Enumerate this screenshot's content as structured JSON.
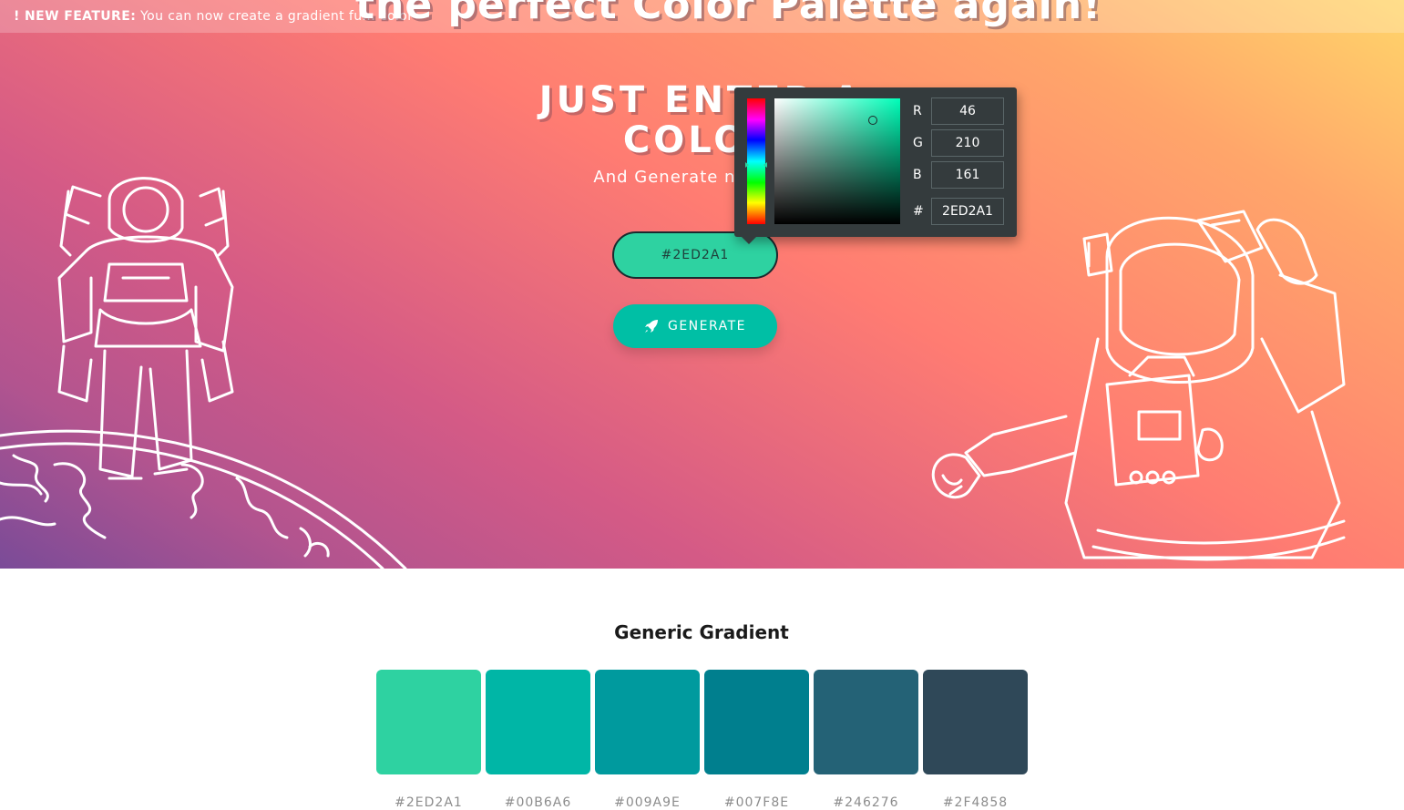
{
  "banner": {
    "label": "! NEW FEATURE:",
    "text": "You can now create a gradient fu... color"
  },
  "hero": {
    "title": "the perfect Color Palette again!",
    "headline_line1": "JUST ENTER A",
    "headline_line2": "COLOR",
    "subtitle": "And Generate nice Co...",
    "color_input_value": "#2ED2A1",
    "generate_label": "GENERATE",
    "generate_icon": "rocket-icon",
    "illustrations": [
      "astronaut-on-planet",
      "astronaut-waving"
    ]
  },
  "picker": {
    "r_label": "R",
    "r_value": "46",
    "g_label": "G",
    "g_value": "210",
    "b_label": "B",
    "b_value": "161",
    "hex_label": "#",
    "hex_value": "2ED2A1"
  },
  "palette": {
    "title": "Generic Gradient",
    "swatches": [
      {
        "color": "#2ED2A1",
        "label": "#2ED2A1"
      },
      {
        "color": "#00B6A6",
        "label": "#00B6A6"
      },
      {
        "color": "#009A9E",
        "label": "#009A9E"
      },
      {
        "color": "#007F8E",
        "label": "#007F8E"
      },
      {
        "color": "#246276",
        "label": "#246276"
      },
      {
        "color": "#2F4858",
        "label": "#2F4858"
      }
    ]
  },
  "colors": {
    "accent": "#00BFA5",
    "input_bg": "#2ED2A1",
    "picker_bg": "#343B3D"
  }
}
